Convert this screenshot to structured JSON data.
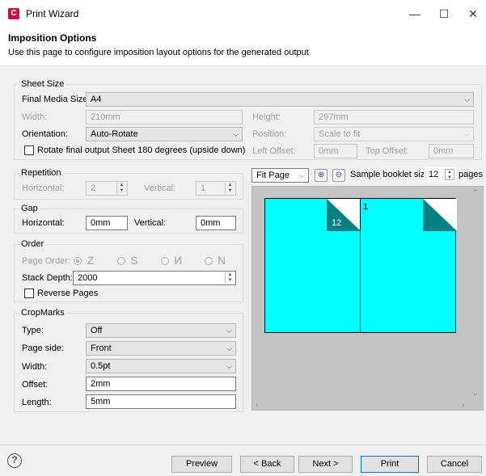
{
  "window": {
    "title": "Print Wizard",
    "app_icon": "C",
    "minimize": "—",
    "maximize": "☐",
    "close": "✕"
  },
  "header": {
    "title": "Imposition Options",
    "description": "Use this page to configure imposition layout options for the generated output"
  },
  "sheet_size": {
    "title": "Sheet Size",
    "final_media_label": "Final Media Size:",
    "final_media_value": "A4",
    "width_label": "Width:",
    "width_value": "210mm",
    "height_label": "Height:",
    "height_value": "297mm",
    "orientation_label": "Orientation:",
    "orientation_value": "Auto-Rotate",
    "position_label": "Position:",
    "position_value": "Scale to fit",
    "rotate_label": "Rotate final output Sheet 180 degrees (upside down)",
    "left_offset_label": "Left Offset:",
    "left_offset_value": "0mm",
    "top_offset_label": "Top Offset:",
    "top_offset_value": "0mm"
  },
  "repetition": {
    "title": "Repetition",
    "horizontal_label": "Horizontal:",
    "horizontal_value": "2",
    "vertical_label": "Vertical:",
    "vertical_value": "1"
  },
  "gap": {
    "title": "Gap",
    "horizontal_label": "Horizontal:",
    "horizontal_value": "0mm",
    "vertical_label": "Vertical:",
    "vertical_value": "0mm"
  },
  "order": {
    "title": "Order",
    "page_order_label": "Page Order:",
    "stack_depth_label": "Stack Depth:",
    "stack_depth_value": "2000",
    "reverse_label": "Reverse Pages"
  },
  "cropmarks": {
    "title": "CropMarks",
    "type_label": "Type:",
    "type_value": "Off",
    "page_side_label": "Page side:",
    "page_side_value": "Front",
    "width_label": "Width:",
    "width_value": "0.5pt",
    "offset_label": "Offset:",
    "offset_value": "2mm",
    "length_label": "Length:",
    "length_value": "5mm"
  },
  "preview": {
    "fit_value": "Fit Page",
    "booklet_label": "Sample booklet size:",
    "booklet_value": "12",
    "pages_label": "pages",
    "left_page_number": "12",
    "right_page_number": "1",
    "page_color": "#00ffff",
    "fold_color": "#008080"
  },
  "buttons": {
    "help": "?",
    "preview": "Preview",
    "back": "< Back",
    "next": "Next >",
    "print": "Print",
    "cancel": "Cancel"
  }
}
